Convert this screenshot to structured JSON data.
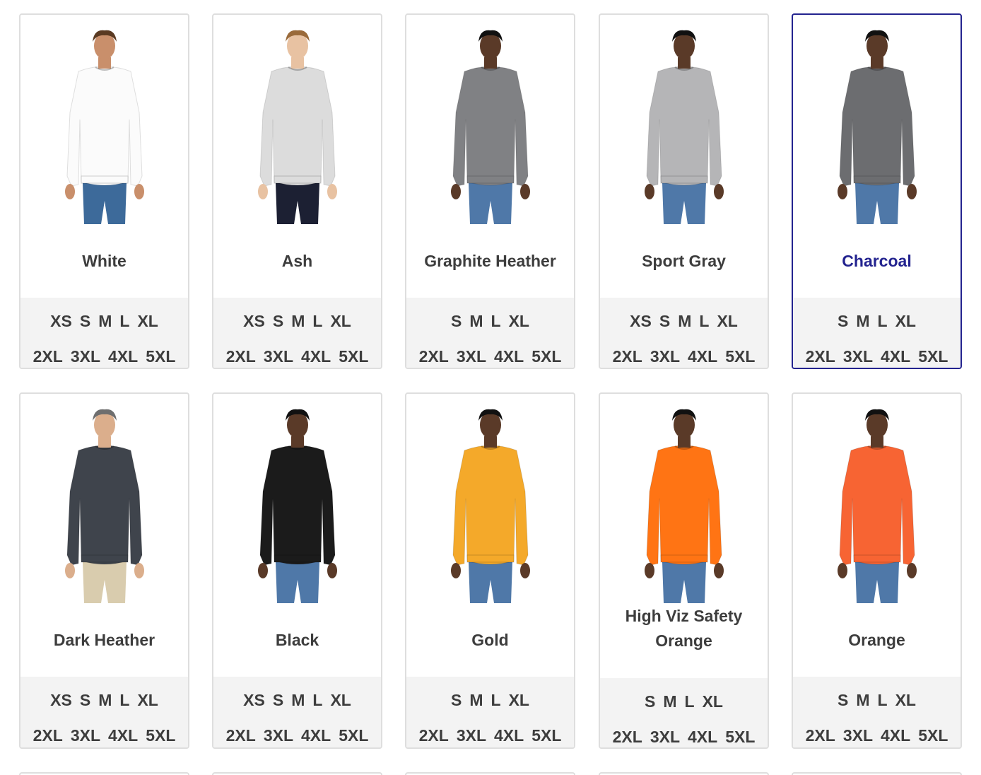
{
  "colors": {
    "selected_accent": "#23238f"
  },
  "swatches": [
    {
      "name": "White",
      "selected": false,
      "tall": false,
      "sweater": "#fbfbfb",
      "pants": "#3d6a9a",
      "skin": "#c98f6b",
      "hair": "#5a3a22",
      "sizes_row1": [
        "XS",
        "S",
        "M",
        "L",
        "XL"
      ],
      "sizes_row2": [
        "2XL",
        "3XL",
        "4XL",
        "5XL"
      ]
    },
    {
      "name": "Ash",
      "selected": false,
      "tall": false,
      "sweater": "#dcdcdc",
      "pants": "#1c2033",
      "skin": "#e8c2a2",
      "hair": "#9a6a3a",
      "sizes_row1": [
        "XS",
        "S",
        "M",
        "L",
        "XL"
      ],
      "sizes_row2": [
        "2XL",
        "3XL",
        "4XL",
        "5XL"
      ]
    },
    {
      "name": "Graphite Heather",
      "selected": false,
      "tall": false,
      "sweater": "#808184",
      "pants": "#4f78a8",
      "skin": "#5a3a28",
      "hair": "#111111",
      "sizes_row1": [
        "S",
        "M",
        "L",
        "XL"
      ],
      "sizes_row2": [
        "2XL",
        "3XL",
        "4XL",
        "5XL"
      ]
    },
    {
      "name": "Sport Gray",
      "selected": false,
      "tall": false,
      "sweater": "#b5b5b7",
      "pants": "#4f78a8",
      "skin": "#5a3a28",
      "hair": "#111111",
      "sizes_row1": [
        "XS",
        "S",
        "M",
        "L",
        "XL"
      ],
      "sizes_row2": [
        "2XL",
        "3XL",
        "4XL",
        "5XL"
      ]
    },
    {
      "name": "Charcoal",
      "selected": true,
      "tall": false,
      "sweater": "#6c6d70",
      "pants": "#4f78a8",
      "skin": "#5a3a28",
      "hair": "#111111",
      "sizes_row1": [
        "S",
        "M",
        "L",
        "XL"
      ],
      "sizes_row2": [
        "2XL",
        "3XL",
        "4XL",
        "5XL"
      ]
    },
    {
      "name": "Dark Heather",
      "selected": false,
      "tall": false,
      "sweater": "#3f444c",
      "pants": "#d9ccae",
      "skin": "#dbae8c",
      "hair": "#6e6e6e",
      "sizes_row1": [
        "XS",
        "S",
        "M",
        "L",
        "XL"
      ],
      "sizes_row2": [
        "2XL",
        "3XL",
        "4XL",
        "5XL"
      ]
    },
    {
      "name": "Black",
      "selected": false,
      "tall": false,
      "sweater": "#1b1b1b",
      "pants": "#4f78a8",
      "skin": "#5a3a28",
      "hair": "#111111",
      "sizes_row1": [
        "XS",
        "S",
        "M",
        "L",
        "XL"
      ],
      "sizes_row2": [
        "2XL",
        "3XL",
        "4XL",
        "5XL"
      ]
    },
    {
      "name": "Gold",
      "selected": false,
      "tall": false,
      "sweater": "#f4a92a",
      "pants": "#4f78a8",
      "skin": "#5a3a28",
      "hair": "#111111",
      "sizes_row1": [
        "S",
        "M",
        "L",
        "XL"
      ],
      "sizes_row2": [
        "2XL",
        "3XL",
        "4XL",
        "5XL"
      ]
    },
    {
      "name": "High Viz Safety Orange",
      "selected": false,
      "tall": true,
      "sweater": "#ff7414",
      "pants": "#4f78a8",
      "skin": "#5a3a28",
      "hair": "#111111",
      "sizes_row1": [
        "S",
        "M",
        "L",
        "XL"
      ],
      "sizes_row2": [
        "2XL",
        "3XL",
        "4XL",
        "5XL"
      ]
    },
    {
      "name": "Orange",
      "selected": false,
      "tall": false,
      "sweater": "#f76433",
      "pants": "#4f78a8",
      "skin": "#5a3a28",
      "hair": "#111111",
      "sizes_row1": [
        "S",
        "M",
        "L",
        "XL"
      ],
      "sizes_row2": [
        "2XL",
        "3XL",
        "4XL",
        "5XL"
      ]
    }
  ]
}
